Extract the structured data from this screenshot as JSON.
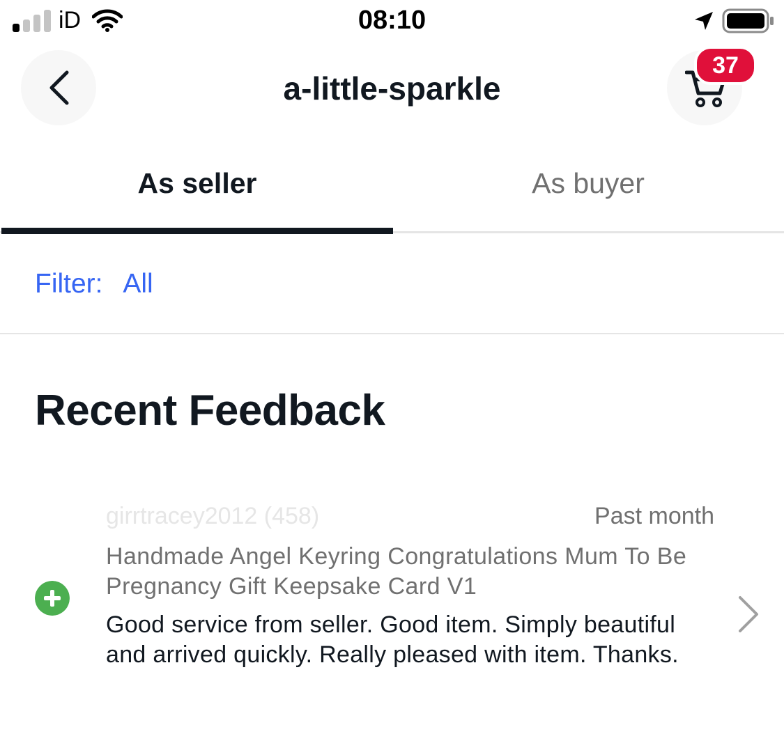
{
  "status_bar": {
    "time": "08:10",
    "carrier": "iD",
    "icons": [
      "signal-icon",
      "wifi-icon",
      "location-arrow-icon",
      "battery-icon"
    ]
  },
  "header": {
    "title": "a-little-sparkle",
    "cart_count": "37",
    "icons": [
      "back-chevron-icon",
      "cart-icon"
    ]
  },
  "tabs": [
    {
      "label": "As seller",
      "active": true
    },
    {
      "label": "As buyer",
      "active": false
    }
  ],
  "filter": {
    "label": "Filter:",
    "value": "All"
  },
  "section": {
    "title": "Recent Feedback"
  },
  "feedback": [
    {
      "user": "girrtracey2012 (458)",
      "time": "Past month",
      "item": "Handmade Angel Keyring Congratulations Mum To Be Pregnancy Gift Keepsake Card V1",
      "comment": "Good service from seller. Good item. Simply beautiful and arrived quickly. Really pleased with item. Thanks.",
      "rating_icon": "positive-plus-icon"
    }
  ],
  "colors": {
    "text_primary": "#111820",
    "text_secondary": "#707070",
    "link_blue": "#3665f3",
    "badge_red": "#e0103a",
    "positive_green": "#4caf50",
    "divider": "#e5e5e5"
  }
}
